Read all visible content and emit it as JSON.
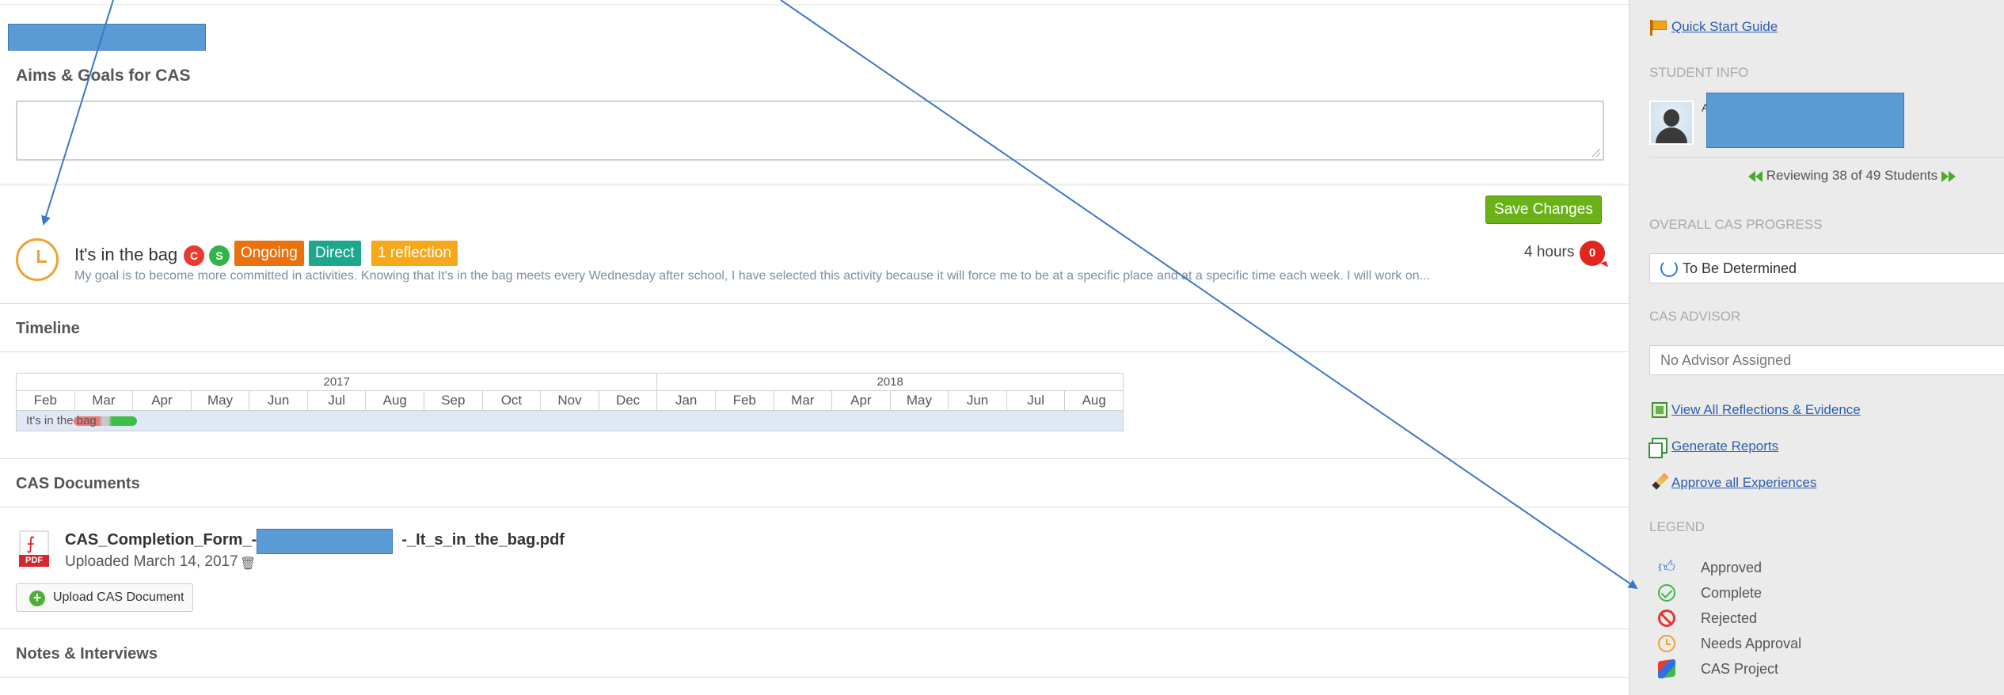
{
  "main": {
    "aims_label": "Aims & Goals for CAS",
    "aims_value": "",
    "save_button": "Save Changes",
    "experience": {
      "title": "It's in the bag",
      "strand_c": "C",
      "strand_s": "S",
      "tag_ongoing": "Ongoing",
      "tag_direct": "Direct",
      "tag_reflection": "1 reflection",
      "description": "My goal is to become more committed in activities. Knowing that It's in the bag meets every Wednesday after school, I have selected this activity because it will force me to be at a specific place and at a specific time each week. I will work on...",
      "hours": "4 hours",
      "comment_count": "0"
    },
    "timeline": {
      "heading": "Timeline",
      "years": [
        {
          "label": "2017"
        },
        {
          "label": "2018"
        }
      ],
      "months": [
        "Feb",
        "Mar",
        "Apr",
        "May",
        "Jun",
        "Jul",
        "Aug",
        "Sep",
        "Oct",
        "Nov",
        "Dec",
        "Jan",
        "Feb",
        "Mar",
        "Apr",
        "May",
        "Jun",
        "Jul",
        "Aug"
      ],
      "bar_label": "It's in the bag"
    },
    "documents": {
      "heading": "CAS Documents",
      "file_prefix": "CAS_Completion_Form_-_",
      "file_suffix": "-_It_s_in_the_bag.pdf",
      "pdf_label": "PDF",
      "uploaded": "Uploaded March 14, 2017",
      "upload_button": "Upload CAS Document"
    },
    "notes_heading": "Notes & Interviews"
  },
  "sidebar": {
    "quick_start": "Quick Start Guide",
    "student_info_heading": "STUDENT INFO",
    "student_initial": "A",
    "reviewing": "Reviewing 38 of 49 Students",
    "progress_heading": "OVERALL CAS PROGRESS",
    "progress_value": "To Be Determined",
    "advisor_heading": "CAS ADVISOR",
    "advisor_value": "No Advisor Assigned",
    "links": {
      "view_all": "View All Reflections & Evidence",
      "generate": "Generate Reports",
      "approve": "Approve all Experiences"
    },
    "legend_heading": "LEGEND",
    "legend": [
      {
        "label": "Approved",
        "icon": "thumbs-up-icon"
      },
      {
        "label": "Complete",
        "icon": "check-circle-icon"
      },
      {
        "label": "Rejected",
        "icon": "ban-icon"
      },
      {
        "label": "Needs Approval",
        "icon": "clock-icon"
      },
      {
        "label": "CAS Project",
        "icon": "cube-icon"
      }
    ]
  },
  "colors": {
    "accent_green": "#6ab218",
    "tag_orange": "#e8730e",
    "tag_teal": "#1ea78c",
    "tag_yellow": "#f6a81a",
    "redaction_blue": "#5b9bd5",
    "link_blue": "#2a5db0"
  }
}
